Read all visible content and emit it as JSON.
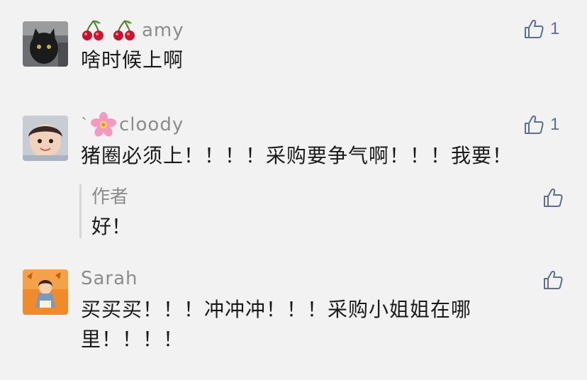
{
  "accent_color": "#5a6f95",
  "comments": [
    {
      "name": "amy",
      "name_prefix_emoji": "cherries-icon x2",
      "text": "啥时候上啊",
      "like_count": "1"
    },
    {
      "name": "cloody",
      "name_prefix_text": "`",
      "name_prefix_emoji": "cherry-blossom-icon",
      "text": "猪圈必须上！！！！采购要争气啊！！！我要！",
      "like_count": "1",
      "reply": {
        "author": "作者",
        "text": "好！"
      }
    },
    {
      "name": "Sarah",
      "text_line1": "买买买！！！冲冲冲！！！采购小姐姐在哪",
      "text_line2": "里！！！！"
    }
  ]
}
